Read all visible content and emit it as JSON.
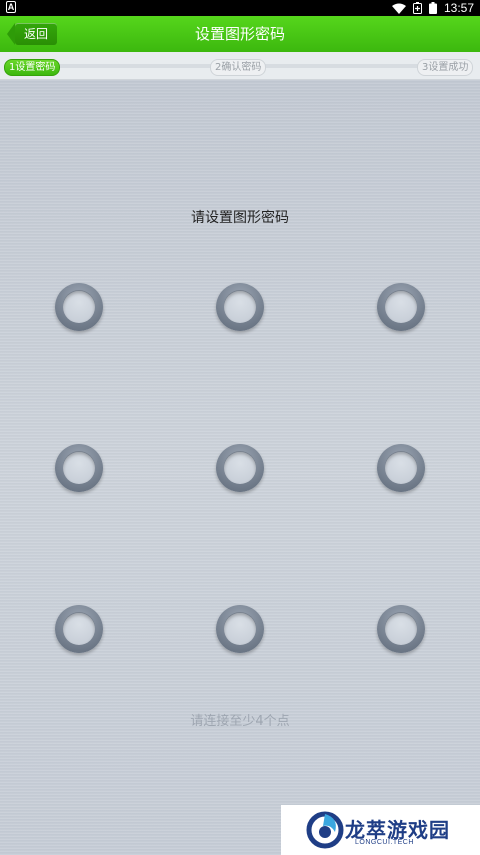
{
  "status_bar": {
    "notification_glyph": "A",
    "time": "13:57",
    "icons": [
      "wifi-icon",
      "battery-saver-icon",
      "battery-icon"
    ]
  },
  "header": {
    "back_label": "返回",
    "title": "设置图形密码"
  },
  "steps": [
    {
      "label": "1设置密码",
      "active": true
    },
    {
      "label": "2确认密码",
      "active": false
    },
    {
      "label": "3设置成功",
      "active": false
    }
  ],
  "lock": {
    "prompt": "请设置图形密码",
    "hint": "请连接至少4个点",
    "dots": [
      1,
      2,
      3,
      4,
      5,
      6,
      7,
      8,
      9
    ]
  },
  "watermark": {
    "name": "龙萃游戏园",
    "sub": "LONGCUI.TECH"
  },
  "colors": {
    "header_green": "#3cb80e",
    "panel_gray": "#c9d0da",
    "watermark_blue": "#1f3e86"
  }
}
